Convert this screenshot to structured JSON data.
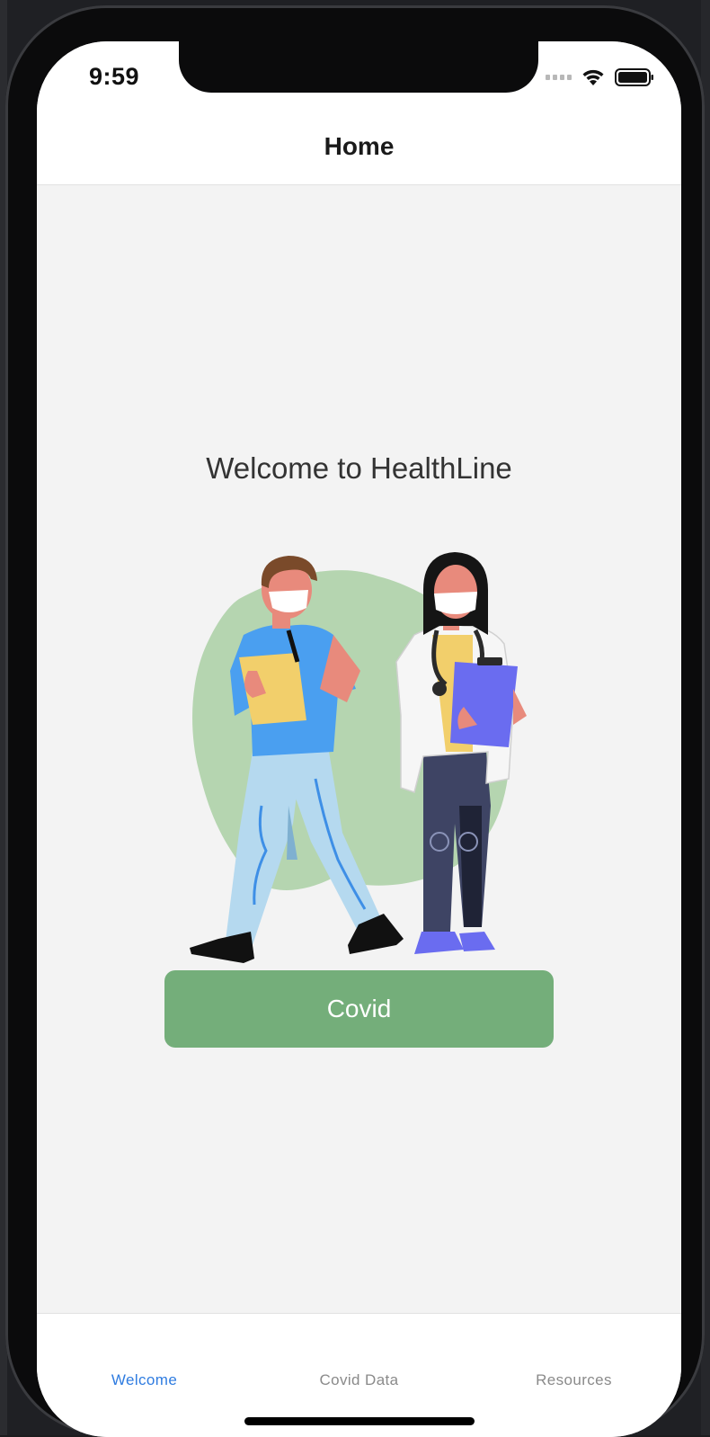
{
  "status_bar": {
    "time": "9:59"
  },
  "nav": {
    "title": "Home"
  },
  "main": {
    "welcome_text": "Welcome to HealthLine",
    "covid_button_label": "Covid"
  },
  "tabs": [
    {
      "label": "Welcome",
      "active": true
    },
    {
      "label": "Covid Data",
      "active": false
    },
    {
      "label": "Resources",
      "active": false
    }
  ],
  "colors": {
    "accent": "#2f7ce0",
    "tab_inactive": "#8a8a8a",
    "button": "#74ae7a",
    "background": "#f3f3f3"
  },
  "icons": {
    "signal": "cellular-signal-icon",
    "wifi": "wifi-icon",
    "battery": "battery-icon",
    "illustration": "medical-staff-illustration"
  }
}
